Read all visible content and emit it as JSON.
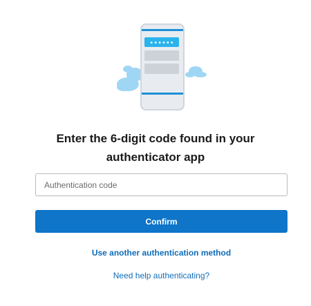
{
  "illustration": {
    "icon": "phone-authenticator-icon",
    "code_mask": "••••••",
    "colors": {
      "phone_body": "#e8ecf1",
      "phone_edge": "#cfd6de",
      "accent": "#2bb3ec",
      "cloud": "#9fd6f3",
      "placeholder_block": "#cdd2d8"
    }
  },
  "heading": {
    "line1": "Enter the 6-digit code found in your",
    "line2": "authenticator app"
  },
  "code_input": {
    "value": "",
    "placeholder": "Authentication code"
  },
  "confirm_button": {
    "label": "Confirm",
    "color": "#0e75c9"
  },
  "links": {
    "another_method": "Use another authentication method",
    "need_help": "Need help authenticating?",
    "color": "#0f6cb8"
  }
}
